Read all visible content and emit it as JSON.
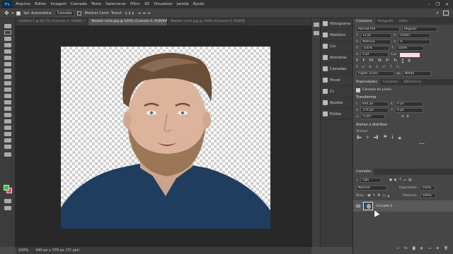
{
  "app": {
    "logo": "Ps"
  },
  "menu": [
    "Arquivo",
    "Editar",
    "Imagem",
    "Camada",
    "Texto",
    "Selecionar",
    "Filtro",
    "3D",
    "Visualizar",
    "Janela",
    "Ajuda"
  ],
  "window_controls": [
    "–",
    "❐",
    "✕"
  ],
  "options_bar": {
    "auto_select": "Sel. Automática",
    "auto_select_target": "Camada",
    "show_controls": "Mostrar Contr. Transf."
  },
  "tabs": [
    {
      "label": "Untitled-1 @ 66,7% (Camada 1, RGB/8) *",
      "active": false
    },
    {
      "label": "Modelo corte.jpg @ 100% (Camada 0, RGB/8#) *",
      "active": true
    },
    {
      "label": "Modelo corte.jpg @ 100% (Camada 0, RGB/8) *",
      "active": false
    }
  ],
  "status": {
    "zoom": "100%",
    "doc": "440 px x 376 px (72 ppi)"
  },
  "side_panel": [
    "Histograma",
    "Histórico",
    "Cor",
    "Amostras",
    "Camadas",
    "Pincel",
    "Cc",
    "Ajustes",
    "Estilos"
  ],
  "character": {
    "tabs": [
      "Caractere",
      "Parágrafo",
      "Glifos"
    ],
    "font": "Myriad Pro",
    "style": "Regular",
    "size": "12 pt",
    "leading": "(Auto)",
    "tracking": "Métrica",
    "kerning": "0",
    "scale_v": "100%",
    "scale_h": "100%",
    "baseline": "0 pt",
    "color_label": "Cor:",
    "language": "Inglês (EUA)",
    "aa": "Nítido"
  },
  "properties": {
    "tabs": [
      "Propriedades",
      "Camadas",
      "Bibliotecas"
    ],
    "title": "Camada de pixels",
    "section": "Transformar",
    "w": "440 px",
    "x": "0 px",
    "h": "376 px",
    "y": "0 px",
    "angle": "0,00°",
    "align_title": "Alinhar e distribuir",
    "align_sub": "Alinhar:"
  },
  "layers": {
    "tab": "Camadas",
    "kind": "Tipo",
    "blend": "Normal",
    "opacity_label": "Opacidade:",
    "opacity": "100%",
    "fill_label": "Preench.:",
    "fill": "100%",
    "lock_label": "Bloq.:",
    "layer_name": "Camada 0"
  },
  "icon_names": {
    "move": "move-icon",
    "eye": "visibility-icon",
    "search": "search-icon"
  }
}
